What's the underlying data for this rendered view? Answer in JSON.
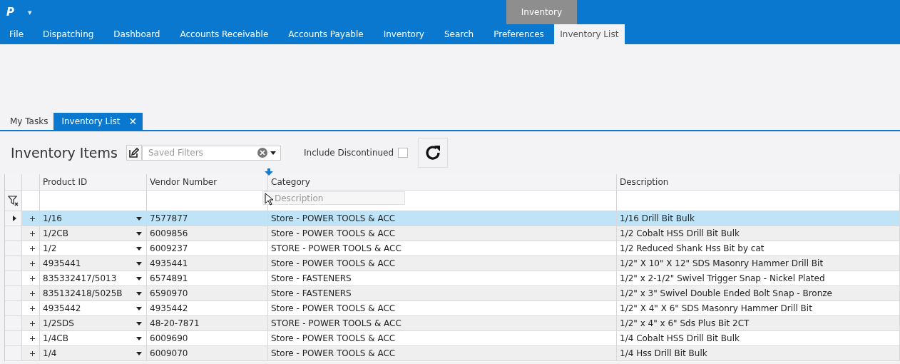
{
  "app": {
    "logo": "P",
    "quick_access": "▾"
  },
  "context_tab": {
    "title": "Inventory"
  },
  "menu": [
    {
      "label": "File",
      "selected": false
    },
    {
      "label": "Dispatching",
      "selected": false
    },
    {
      "label": "Dashboard",
      "selected": false
    },
    {
      "label": "Accounts Receivable",
      "selected": false
    },
    {
      "label": "Accounts Payable",
      "selected": false
    },
    {
      "label": "Inventory",
      "selected": false
    },
    {
      "label": "Search",
      "selected": false
    },
    {
      "label": "Preferences",
      "selected": false
    },
    {
      "label": "Inventory List",
      "selected": true
    }
  ],
  "doc_tabs": [
    {
      "label": "My Tasks",
      "selected": false
    },
    {
      "label": "Inventory List",
      "selected": true,
      "close": "✕"
    }
  ],
  "toolbar": {
    "title": "Inventory Items",
    "saved_filters": {
      "placeholder": "Saved Filters"
    },
    "include_discontinued": {
      "label": "Include Discontinued",
      "checked": false
    }
  },
  "table": {
    "columns": [
      "Product ID",
      "Vendor Number",
      "Category",
      "Description"
    ],
    "drag_ghost": "Description",
    "rows": [
      {
        "selected": true,
        "product_id": "1/16",
        "vendor": "7577877",
        "category": "Store - POWER TOOLS & ACC",
        "description": "1/16 Drill Bit Bulk"
      },
      {
        "selected": false,
        "product_id": "1/2CB",
        "vendor": "6009856",
        "category": "Store - POWER TOOLS & ACC",
        "description": "1/2 Cobalt HSS Drill Bit Bulk"
      },
      {
        "selected": false,
        "product_id": "1/2",
        "vendor": "6009237",
        "category": "STORE - POWER TOOLS & ACC",
        "description": "1/2 Reduced Shank Hss Bit by cat"
      },
      {
        "selected": false,
        "product_id": "4935441",
        "vendor": "4935441",
        "category": "Store - POWER TOOLS & ACC",
        "description": "1/2\" X 10\" X 12\" SDS Masonry Hammer Drill Bit"
      },
      {
        "selected": false,
        "product_id": "835332417/5013",
        "vendor": "6574891",
        "category": "Store - FASTENERS",
        "description": "1/2\" x 2-1/2\" Swivel Trigger Snap - Nickel Plated"
      },
      {
        "selected": false,
        "product_id": "835132418/5025B",
        "vendor": "6590970",
        "category": "Store - FASTENERS",
        "description": "1/2\" x 3\" Swivel Double Ended Bolt Snap - Bronze"
      },
      {
        "selected": false,
        "product_id": "4935442",
        "vendor": "4935442",
        "category": "Store - POWER TOOLS & ACC",
        "description": "1/2\" X 4\" X 6\" SDS Masonry Hammer Drill Bit"
      },
      {
        "selected": false,
        "product_id": "1/2SDS",
        "vendor": "48-20-7871",
        "category": "STORE - POWER TOOLS & ACC",
        "description": "1/2\" x 4\" x 6\" Sds Plus Bit 2CT"
      },
      {
        "selected": false,
        "product_id": "1/4CB",
        "vendor": "6009690",
        "category": "Store - POWER TOOLS & ACC",
        "description": "1/4 Cobalt HSS Drill Bit Bulk"
      },
      {
        "selected": false,
        "product_id": "1/4",
        "vendor": "6009070",
        "category": "Store - POWER TOOLS & ACC",
        "description": "1/4 Hss Drill Bit Bulk"
      }
    ]
  }
}
